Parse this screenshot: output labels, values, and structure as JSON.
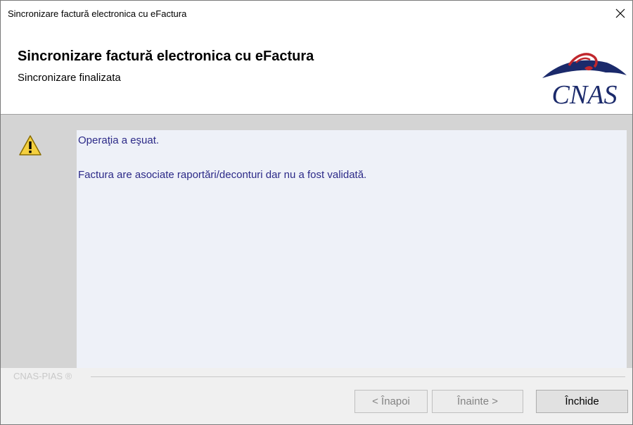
{
  "window": {
    "title": "Sincronizare factură electronica cu eFactura",
    "close_icon": "close-icon"
  },
  "header": {
    "heading": "Sincronizare factură electronica cu eFactura",
    "subheading": "Sincronizare finalizata",
    "logo_text": "CNAS",
    "logo_color": "#1b2a6b"
  },
  "message": {
    "icon": "warning-icon",
    "line1": "Operaţia a eşuat.",
    "line2": "Factura are asociate raportări/deconturi dar nu a fost validată.",
    "text_color": "#2c2a88"
  },
  "footer": {
    "brand": "CNAS-PIAS ®",
    "back_label": "< Înapoi",
    "next_label": "Înainte >",
    "close_label": "Închide"
  }
}
